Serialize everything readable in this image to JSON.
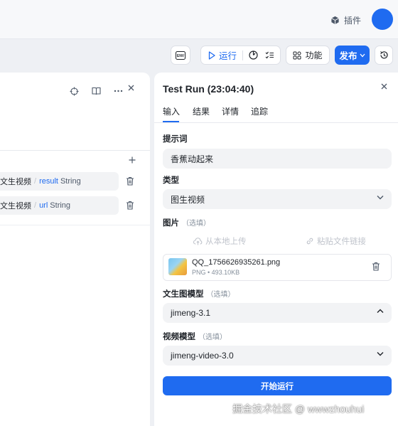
{
  "header": {
    "plugin_label": "插件"
  },
  "toolbar": {
    "run_label": "运行",
    "function_label": "功能",
    "publish_label": "发布"
  },
  "left_panel": {
    "variables": [
      {
        "source": "文生视频",
        "name": "result",
        "type": "String"
      },
      {
        "source": "文生视频",
        "name": "url",
        "type": "String"
      }
    ]
  },
  "test_run": {
    "title": "Test Run (23:04:40)",
    "tabs": [
      "输入",
      "结果",
      "详情",
      "追踪"
    ],
    "active_tab": "输入",
    "fields": {
      "prompt_label": "提示词",
      "prompt_value": "香蕉动起来",
      "type_label": "类型",
      "type_value": "图生视频",
      "image_label": "图片",
      "image_optional": "（选填）",
      "upload_local": "从本地上传",
      "paste_link": "粘贴文件链接",
      "file_name": "QQ_1756626935261.png",
      "file_meta": "PNG • 493.10KB",
      "t2i_model_label": "文生图模型",
      "t2i_model_optional": "（选填）",
      "t2i_model_value": "jimeng-3.1",
      "video_model_label": "视频模型",
      "video_model_optional": "（选填）",
      "video_model_value": "jimeng-video-3.0"
    },
    "start_button": "开始运行"
  },
  "watermark": "掘金技术社区 @ wwwzhouhui",
  "colors": {
    "accent": "#1f6bf0",
    "field_bg": "#f2f3f5"
  }
}
